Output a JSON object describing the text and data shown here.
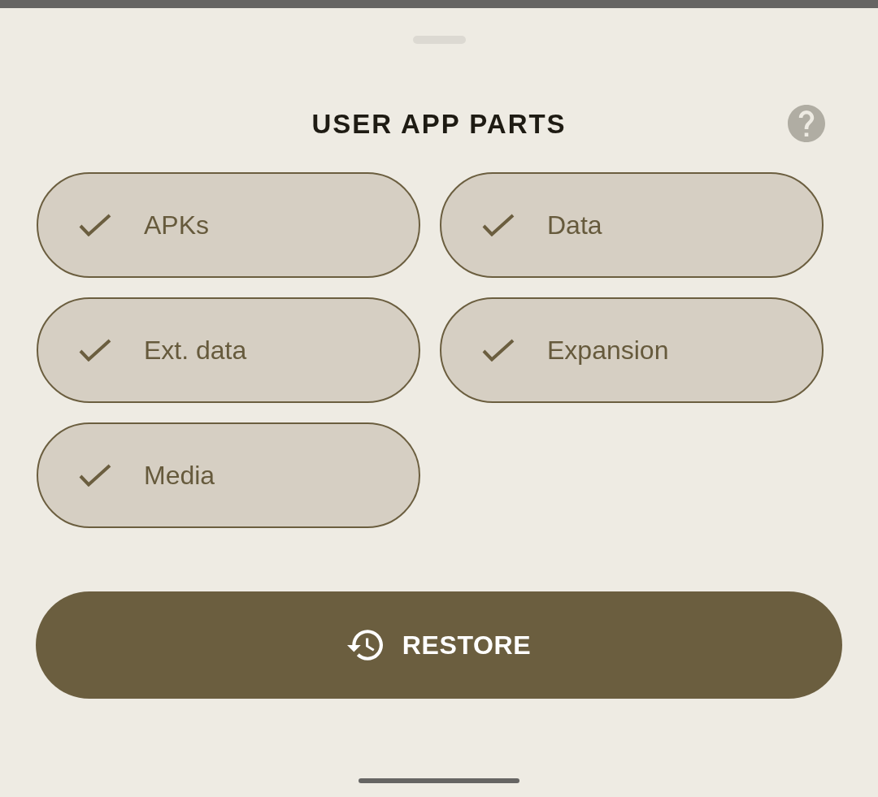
{
  "title": "USER APP PARTS",
  "parts": [
    {
      "label": "APKs",
      "checked": true
    },
    {
      "label": "Data",
      "checked": true
    },
    {
      "label": "Ext. data",
      "checked": true
    },
    {
      "label": "Expansion",
      "checked": true
    },
    {
      "label": "Media",
      "checked": true
    }
  ],
  "restore_button": {
    "label": "RESTORE"
  }
}
